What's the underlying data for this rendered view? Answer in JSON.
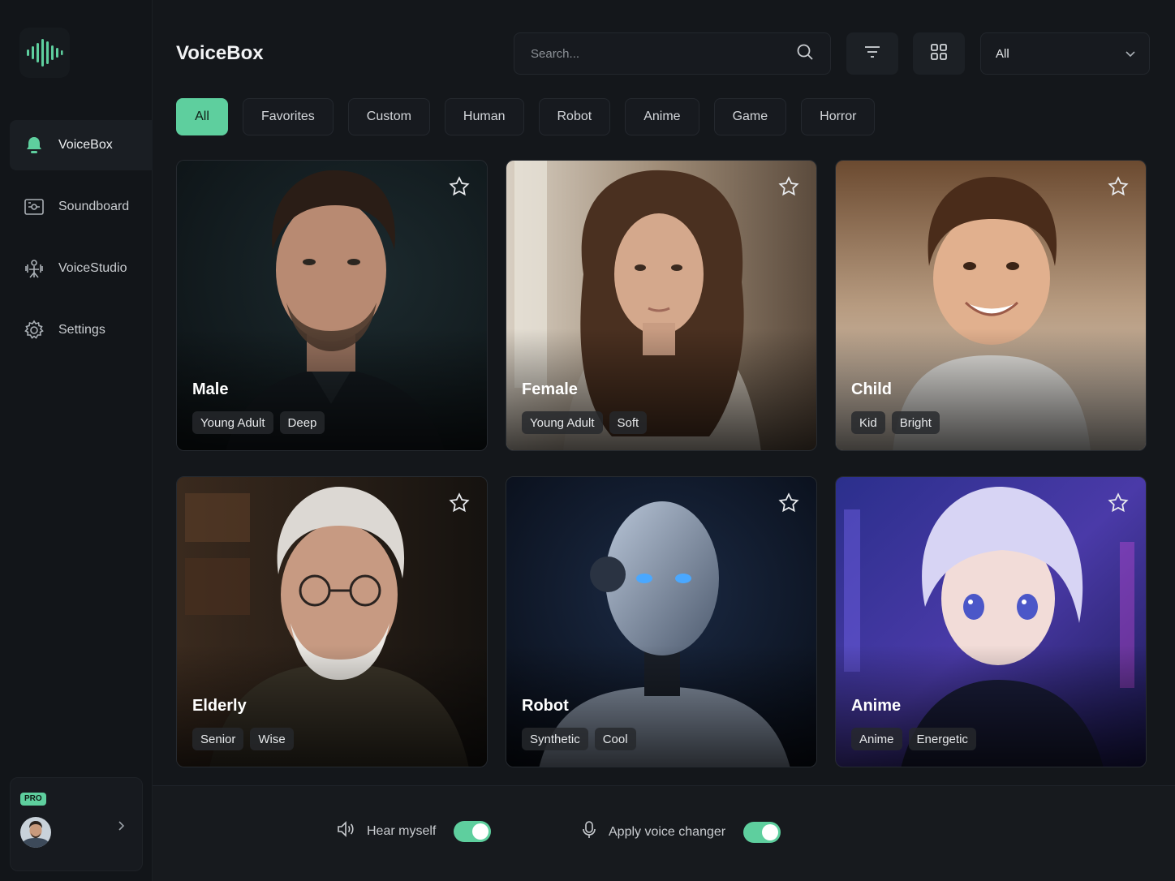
{
  "app": {
    "title": "VoiceBox"
  },
  "sidebar": {
    "items": [
      {
        "label": "VoiceBox",
        "icon": "voicebox-bell-icon",
        "active": true
      },
      {
        "label": "Soundboard",
        "icon": "soundboard-icon",
        "active": false
      },
      {
        "label": "VoiceStudio",
        "icon": "voice-studio-icon",
        "active": false
      },
      {
        "label": "Settings",
        "icon": "gear-icon",
        "active": false
      }
    ],
    "profile": {
      "badge": "PRO"
    }
  },
  "header": {
    "search_placeholder": "Search...",
    "select_value": "All"
  },
  "filters": [
    "All",
    "Favorites",
    "Custom",
    "Human",
    "Robot",
    "Anime",
    "Game",
    "Horror"
  ],
  "active_filter": "All",
  "voices": [
    {
      "name": "Male",
      "tags": [
        "Young Adult",
        "Deep"
      ]
    },
    {
      "name": "Female",
      "tags": [
        "Young Adult",
        "Soft"
      ]
    },
    {
      "name": "Child",
      "tags": [
        "Kid",
        "Bright"
      ]
    },
    {
      "name": "Elderly",
      "tags": [
        "Senior",
        "Wise"
      ]
    },
    {
      "name": "Robot",
      "tags": [
        "Synthetic",
        "Cool"
      ]
    },
    {
      "name": "Anime",
      "tags": [
        "Anime",
        "Energetic"
      ]
    }
  ],
  "footer": {
    "hear_myself_label": "Hear myself",
    "hear_myself_on": true,
    "apply_changer_label": "Apply voice changer",
    "apply_changer_on": true
  },
  "colors": {
    "accent": "#5ecf9e",
    "background": "#14171b"
  }
}
